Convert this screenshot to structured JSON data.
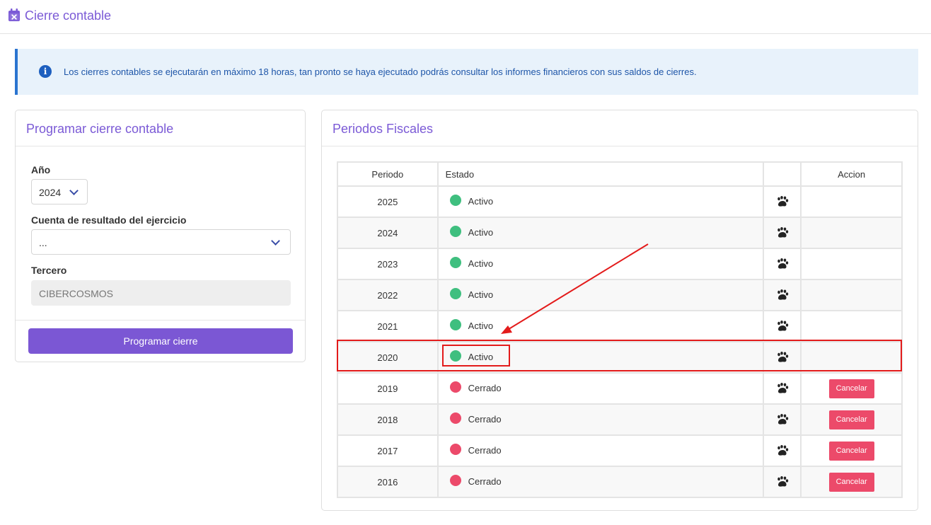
{
  "header": {
    "title": "Cierre contable",
    "icon": "calendar-x-icon"
  },
  "alert": {
    "icon": "info-icon",
    "text": "Los cierres contables se ejecutarán en máximo 18 horas, tan pronto se haya ejecutado podrás consultar los informes financieros con sus saldos de cierres."
  },
  "left_card": {
    "title": "Programar cierre contable",
    "year_label": "Año",
    "year_value": "2024",
    "cuenta_label": "Cuenta de resultado del ejercicio",
    "cuenta_value": "...",
    "tercero_label": "Tercero",
    "tercero_value": "CIBERCOSMOS",
    "button_label": "Programar cierre"
  },
  "right_card": {
    "title": "Periodos Fiscales",
    "columns": [
      "Periodo",
      "Estado",
      "",
      "Accion"
    ],
    "rows": [
      {
        "periodo": "2025",
        "estado": "Activo",
        "status": "active",
        "accion": ""
      },
      {
        "periodo": "2024",
        "estado": "Activo",
        "status": "active",
        "accion": ""
      },
      {
        "periodo": "2023",
        "estado": "Activo",
        "status": "active",
        "accion": ""
      },
      {
        "periodo": "2022",
        "estado": "Activo",
        "status": "active",
        "accion": ""
      },
      {
        "periodo": "2021",
        "estado": "Activo",
        "status": "active",
        "accion": ""
      },
      {
        "periodo": "2020",
        "estado": "Activo",
        "status": "active",
        "accion": "",
        "highlighted": true
      },
      {
        "periodo": "2019",
        "estado": "Cerrado",
        "status": "closed",
        "accion": "Cancelar"
      },
      {
        "periodo": "2018",
        "estado": "Cerrado",
        "status": "closed",
        "accion": "Cancelar"
      },
      {
        "periodo": "2017",
        "estado": "Cerrado",
        "status": "closed",
        "accion": "Cancelar"
      },
      {
        "periodo": "2016",
        "estado": "Cerrado",
        "status": "closed",
        "accion": "Cancelar"
      }
    ],
    "row_icon": "paw-icon"
  },
  "colors": {
    "accent": "#7b57d4",
    "active": "#3fbf7f",
    "closed": "#ec4a6a",
    "annotation": "#e31b1b"
  }
}
